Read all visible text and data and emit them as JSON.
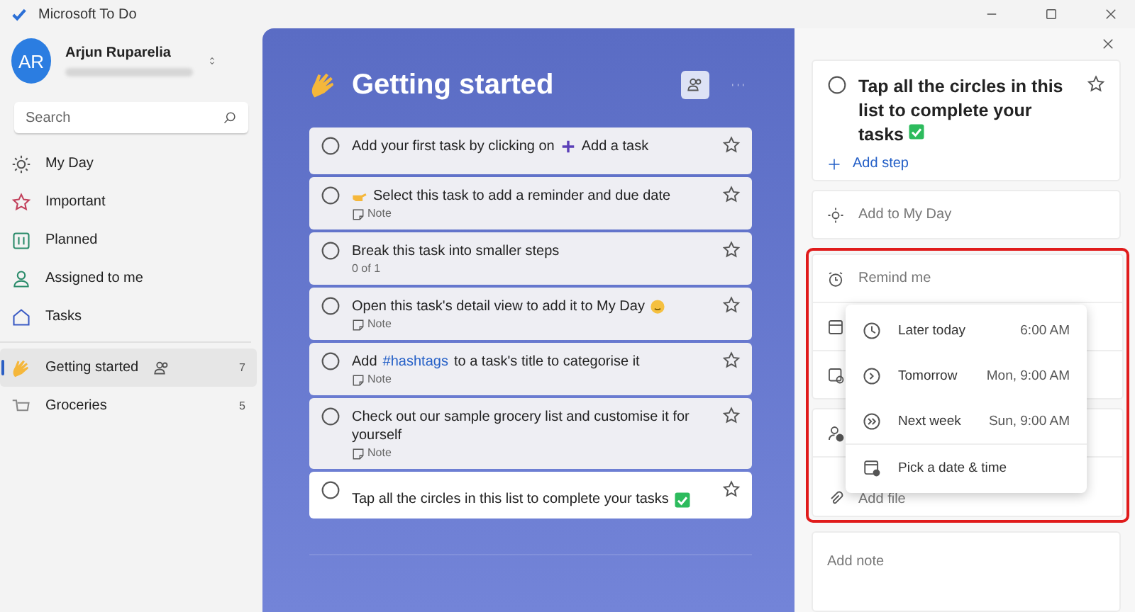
{
  "window": {
    "title": "Microsoft To Do"
  },
  "profile": {
    "initials": "AR",
    "name": "Arjun Ruparelia"
  },
  "search": {
    "placeholder": "Search"
  },
  "sidebar": {
    "items": [
      {
        "kind": "sun",
        "label": "My Day",
        "selected": false
      },
      {
        "kind": "star",
        "label": "Important",
        "selected": false
      },
      {
        "kind": "calendar",
        "label": "Planned",
        "selected": false
      },
      {
        "kind": "person",
        "label": "Assigned to me",
        "selected": false
      },
      {
        "kind": "home",
        "label": "Tasks",
        "selected": false
      }
    ],
    "lists": [
      {
        "kind": "wave",
        "label": "Getting started",
        "shared": true,
        "count": "7",
        "selected": true
      },
      {
        "kind": "cart",
        "label": "Groceries",
        "shared": false,
        "count": "5",
        "selected": false
      }
    ]
  },
  "list": {
    "title": "Getting started",
    "tasks": [
      {
        "kind": "add-hint",
        "text": "Add your first task by clicking on",
        "suffix": "Add a task",
        "selected": false
      },
      {
        "kind": "pointer",
        "text": "Select this task to add a reminder and due date",
        "note": "Note",
        "selected": false
      },
      {
        "kind": "plain",
        "text": "Break this task into smaller steps",
        "steps": "0 of 1",
        "selected": false
      },
      {
        "kind": "smile",
        "text": "Open this task's detail view to add it to My Day",
        "note": "Note",
        "selected": false
      },
      {
        "kind": "hashtag",
        "text": "Add",
        "link": "#hashtags",
        "suffix": "to a task's title to categorise it",
        "note": "Note",
        "selected": false
      },
      {
        "kind": "plain",
        "text": "Check out our sample grocery list and customise it for yourself",
        "note": "Note",
        "selected": false
      },
      {
        "kind": "done",
        "text": "Tap all the circles in this list to complete your tasks",
        "selected": true
      }
    ]
  },
  "detail": {
    "title": "Tap all the circles in this list to complete your tasks",
    "add_step": "Add step",
    "add_to_day": "Add to My Day",
    "remind": "Remind me",
    "file": "Add file",
    "note_placeholder": "Add note",
    "menu": [
      {
        "kind": "later",
        "label": "Later today",
        "time": "6:00 AM"
      },
      {
        "kind": "tomorrow",
        "label": "Tomorrow",
        "time": "Mon, 9:00 AM"
      },
      {
        "kind": "week",
        "label": "Next week",
        "time": "Sun, 9:00 AM"
      },
      {
        "kind": "pick",
        "label": "Pick a date & time"
      }
    ]
  }
}
